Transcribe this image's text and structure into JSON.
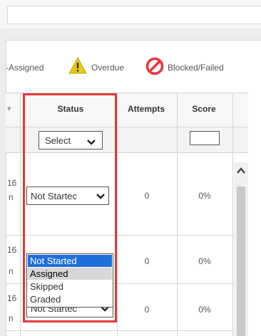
{
  "legend": {
    "assigned_label": "-Assigned",
    "overdue_label": "Overdue",
    "blocked_label": "Blocked/Failed",
    "overdue_color": "#e8c81a",
    "blocked_color": "#e5383b"
  },
  "table": {
    "headers": {
      "status": "Status",
      "attempts": "Attempts",
      "score": "Score"
    },
    "filter": {
      "status_select_value": "Select",
      "score_filter_value": ""
    },
    "rows": [
      {
        "date_fragment_1": "16",
        "date_fragment_2": "n",
        "status": "Not Startec",
        "attempts": "0",
        "score": "0%"
      },
      {
        "date_fragment_1": "16",
        "date_fragment_2": "n",
        "status": "Not Started",
        "attempts": "0",
        "score": "0%"
      },
      {
        "date_fragment_1": "16",
        "date_fragment_2": "n",
        "status": "Not Startec",
        "attempts": "0",
        "score": "0%"
      }
    ]
  },
  "dropdown": {
    "options": [
      "Not Started",
      "Assigned",
      "Skipped",
      "Graded"
    ],
    "selected": "Not Started",
    "hovered": "Assigned"
  },
  "accent_color": "#1e6fd9",
  "highlight_color": "#e5383b"
}
